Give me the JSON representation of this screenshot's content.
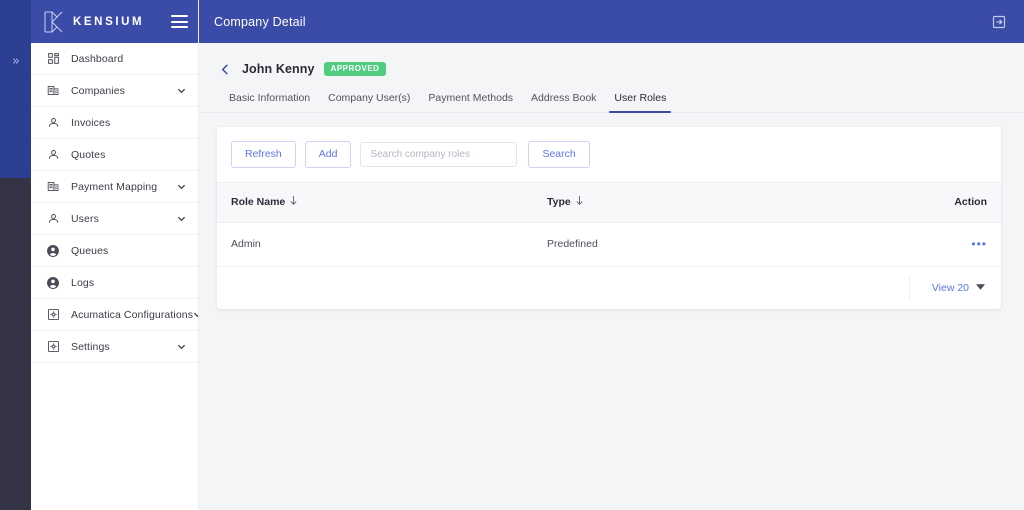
{
  "rail": {
    "expand_icon": "chevrons-right-icon",
    "expand_glyph": "»"
  },
  "brand": {
    "name": "KENSIUM",
    "logo_icon": "kensium-k-logo",
    "menu_icon": "hamburger-menu-icon"
  },
  "sidebar": {
    "items": [
      {
        "label": "Dashboard",
        "icon": "dashboard-grid-icon",
        "expandable": false
      },
      {
        "label": "Companies",
        "icon": "companies-building-icon",
        "expandable": true
      },
      {
        "label": "Invoices",
        "icon": "user-icon",
        "expandable": false
      },
      {
        "label": "Quotes",
        "icon": "user-icon",
        "expandable": false
      },
      {
        "label": "Payment Mapping",
        "icon": "companies-building-icon",
        "expandable": true
      },
      {
        "label": "Users",
        "icon": "user-icon",
        "expandable": true
      },
      {
        "label": "Queues",
        "icon": "account-circle-icon",
        "expandable": false
      },
      {
        "label": "Logs",
        "icon": "account-circle-icon",
        "expandable": false
      },
      {
        "label": "Acumatica Configurations",
        "icon": "settings-square-icon",
        "expandable": true
      },
      {
        "label": "Settings",
        "icon": "settings-square-icon",
        "expandable": true
      }
    ]
  },
  "topbar": {
    "title": "Company Detail",
    "action_icon": "logout-exit-icon"
  },
  "page": {
    "back_icon": "chevron-left-icon",
    "title": "John Kenny",
    "badge": "APPROVED",
    "badge_color": "#4fcc7f"
  },
  "tabs": [
    {
      "label": "Basic Information",
      "active": false
    },
    {
      "label": "Company User(s)",
      "active": false
    },
    {
      "label": "Payment Methods",
      "active": false
    },
    {
      "label": "Address Book",
      "active": false
    },
    {
      "label": "User Roles",
      "active": true
    }
  ],
  "toolbar": {
    "refresh_label": "Refresh",
    "add_label": "Add",
    "search_placeholder": "Search company roles",
    "search_value": "",
    "search_label": "Search"
  },
  "table": {
    "columns": [
      {
        "label": "Role Name",
        "sort_icon": "sort-down-arrow-icon",
        "sortable": true
      },
      {
        "label": "Type",
        "sort_icon": "sort-down-arrow-icon",
        "sortable": true
      },
      {
        "label": "Action",
        "sortable": false
      }
    ],
    "rows": [
      {
        "role_name": "Admin",
        "type": "Predefined",
        "action_icon": "more-options-icon",
        "action_glyph": "•••"
      }
    ]
  },
  "footer": {
    "view_label": "View 20",
    "caret_icon": "chevron-down-icon",
    "caret_glyph": "▼"
  },
  "colors": {
    "brand_blue": "#3b4ba8",
    "rail_dark": "#343446",
    "accent_blue": "#5b76ef",
    "page_bg": "#f4f5f7"
  }
}
